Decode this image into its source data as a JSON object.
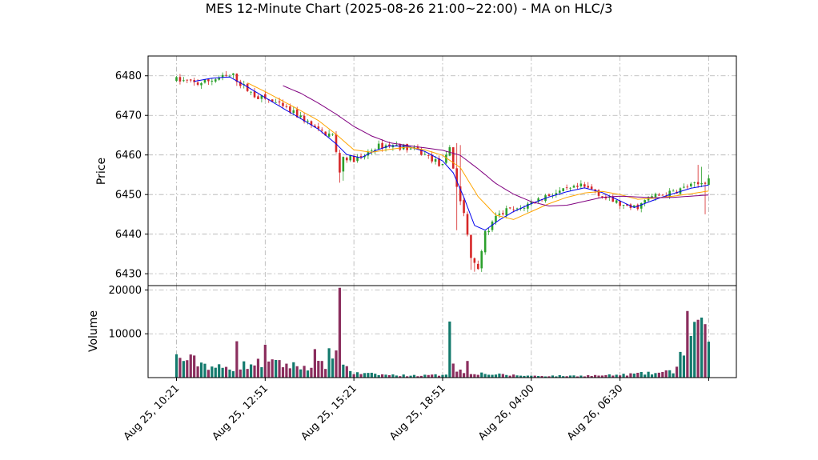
{
  "chart_data": {
    "type": "candlestick",
    "title": "MES 12-Minute Chart (2025-08-26 21:00~22:00) - MA on HLC/3",
    "price_panel": {
      "ylabel": "Price",
      "ylim": [
        6427,
        6485
      ],
      "yticks": [
        6430,
        6440,
        6450,
        6460,
        6470,
        6480
      ],
      "grid": true
    },
    "volume_panel": {
      "ylabel": "Volume",
      "ylim": [
        0,
        21000
      ],
      "yticks": [
        10000,
        20000
      ],
      "grid": true
    },
    "x_tick_labels": [
      "Aug 25, 10:21",
      "Aug 25, 12:51",
      "Aug 25, 15:21",
      "Aug 25, 18:51",
      "Aug 26, 04:00",
      "Aug 26, 06:30"
    ],
    "x_tick_bar_index": [
      0,
      25,
      50,
      75,
      100,
      125
    ],
    "bar_count": 151,
    "up_color": "#2ca02c",
    "down_color": "#d62728",
    "volume_up_color": "#137a6d",
    "volume_down_color": "#8b2e5e",
    "ma_colors": [
      "#0000ee",
      "#ffa500",
      "#800080"
    ],
    "anchors": {
      "close_keypoints": [
        [
          0,
          6479
        ],
        [
          6,
          6478
        ],
        [
          12,
          6479.5
        ],
        [
          16,
          6480
        ],
        [
          18,
          6478
        ],
        [
          22,
          6475
        ],
        [
          27,
          6473.5
        ],
        [
          32,
          6471
        ],
        [
          36,
          6469
        ],
        [
          40,
          6466
        ],
        [
          44,
          6465
        ],
        [
          46,
          6456
        ],
        [
          47,
          6459.5
        ],
        [
          50,
          6459
        ],
        [
          52,
          6459
        ],
        [
          56,
          6462
        ],
        [
          60,
          6462.5
        ],
        [
          64,
          6462
        ],
        [
          68,
          6461
        ],
        [
          72,
          6459
        ],
        [
          75,
          6457
        ],
        [
          77,
          6462
        ],
        [
          79,
          6452
        ],
        [
          81,
          6445
        ],
        [
          83,
          6434
        ],
        [
          85,
          6432
        ],
        [
          87,
          6440
        ],
        [
          90,
          6444
        ],
        [
          93,
          6446
        ],
        [
          96,
          6446
        ],
        [
          100,
          6448
        ],
        [
          105,
          6450
        ],
        [
          110,
          6451
        ],
        [
          114,
          6452
        ],
        [
          118,
          6451
        ],
        [
          121,
          6449
        ],
        [
          124,
          6448
        ],
        [
          127,
          6446.5
        ],
        [
          130,
          6447
        ],
        [
          134,
          6449.5
        ],
        [
          138,
          6450
        ],
        [
          141,
          6451
        ],
        [
          144,
          6452
        ],
        [
          147,
          6452.5
        ],
        [
          150,
          6454
        ]
      ],
      "volume_keypoints": [
        [
          0,
          4500
        ],
        [
          5,
          3800
        ],
        [
          10,
          2500
        ],
        [
          15,
          2000
        ],
        [
          20,
          3000
        ],
        [
          25,
          3200
        ],
        [
          30,
          3000
        ],
        [
          35,
          2500
        ],
        [
          40,
          2800
        ],
        [
          45,
          3200
        ],
        [
          48,
          2500
        ],
        [
          50,
          1000
        ],
        [
          55,
          800
        ],
        [
          60,
          600
        ],
        [
          65,
          500
        ],
        [
          70,
          500
        ],
        [
          74,
          600
        ],
        [
          80,
          1500
        ],
        [
          85,
          1000
        ],
        [
          90,
          700
        ],
        [
          100,
          400
        ],
        [
          110,
          400
        ],
        [
          120,
          500
        ],
        [
          125,
          600
        ],
        [
          130,
          900
        ],
        [
          135,
          1000
        ],
        [
          140,
          1400
        ],
        [
          142,
          5000
        ],
        [
          146,
          9500
        ],
        [
          148,
          11000
        ],
        [
          150,
          3800
        ]
      ],
      "volume_spikes": [
        [
          46,
          20500
        ],
        [
          45,
          6200
        ],
        [
          77,
          12800
        ],
        [
          78,
          3200
        ],
        [
          82,
          3800
        ],
        [
          17,
          8300
        ],
        [
          23,
          4300
        ],
        [
          25,
          7500
        ],
        [
          29,
          4000
        ],
        [
          39,
          6500
        ],
        [
          43,
          6700
        ],
        [
          144,
          15200
        ],
        [
          145,
          9500
        ],
        [
          147,
          13200
        ],
        [
          148,
          13700
        ],
        [
          149,
          12200
        ],
        [
          150,
          8200
        ]
      ],
      "low_wicks": [
        [
          46,
          6453
        ],
        [
          47,
          6453.5
        ],
        [
          79,
          6441
        ],
        [
          83,
          6431
        ],
        [
          84,
          6430.5
        ],
        [
          85,
          6431
        ],
        [
          149,
          6445
        ]
      ],
      "high_wicks": [
        [
          79,
          6463
        ],
        [
          80,
          6462.5
        ],
        [
          148,
          6457
        ],
        [
          147,
          6457.5
        ]
      ],
      "ma_fast_points": [
        [
          5,
          6478.6
        ],
        [
          10,
          6479.4
        ],
        [
          15,
          6479.7
        ],
        [
          20,
          6477.2
        ],
        [
          25,
          6474.5
        ],
        [
          30,
          6471.8
        ],
        [
          35,
          6469.2
        ],
        [
          40,
          6466.5
        ],
        [
          45,
          6462.8
        ],
        [
          48,
          6460.1
        ],
        [
          52,
          6459.3
        ],
        [
          56,
          6461.1
        ],
        [
          60,
          6462.3
        ],
        [
          65,
          6462.2
        ],
        [
          70,
          6460.9
        ],
        [
          75,
          6458.5
        ],
        [
          78,
          6455.5
        ],
        [
          81,
          6449.3
        ],
        [
          84,
          6442.2
        ],
        [
          87,
          6441
        ],
        [
          91,
          6443.6
        ],
        [
          95,
          6445.7
        ],
        [
          100,
          6447.7
        ],
        [
          105,
          6449.4
        ],
        [
          110,
          6450.7
        ],
        [
          115,
          6451.7
        ],
        [
          120,
          6450.5
        ],
        [
          125,
          6448.4
        ],
        [
          129,
          6446.7
        ],
        [
          133,
          6448.1
        ],
        [
          137,
          6449.4
        ],
        [
          141,
          6450.5
        ],
        [
          145,
          6451.6
        ],
        [
          150,
          6452.4
        ]
      ],
      "ma_mid_points": [
        [
          20,
          6478.2
        ],
        [
          25,
          6476
        ],
        [
          30,
          6473.6
        ],
        [
          35,
          6471.2
        ],
        [
          40,
          6468.7
        ],
        [
          45,
          6465.2
        ],
        [
          50,
          6461.3
        ],
        [
          55,
          6460.7
        ],
        [
          60,
          6461.4
        ],
        [
          65,
          6462
        ],
        [
          70,
          6461.3
        ],
        [
          75,
          6459.9
        ],
        [
          80,
          6456.8
        ],
        [
          85,
          6449.5
        ],
        [
          90,
          6444.8
        ],
        [
          95,
          6443.7
        ],
        [
          100,
          6445.7
        ],
        [
          105,
          6447.7
        ],
        [
          110,
          6449.3
        ],
        [
          115,
          6450.4
        ],
        [
          120,
          6450.8
        ],
        [
          125,
          6450
        ],
        [
          130,
          6448.8
        ],
        [
          135,
          6449.1
        ],
        [
          140,
          6449.6
        ],
        [
          145,
          6450.2
        ],
        [
          150,
          6450.9
        ]
      ],
      "ma_slow_points": [
        [
          30,
          6477.5
        ],
        [
          35,
          6475.6
        ],
        [
          40,
          6473.1
        ],
        [
          45,
          6470.3
        ],
        [
          50,
          6467.2
        ],
        [
          55,
          6464.8
        ],
        [
          60,
          6463.1
        ],
        [
          65,
          6462.4
        ],
        [
          70,
          6461.8
        ],
        [
          75,
          6461.2
        ],
        [
          80,
          6459.9
        ],
        [
          85,
          6456.5
        ],
        [
          90,
          6452.8
        ],
        [
          95,
          6450.1
        ],
        [
          100,
          6448.2
        ],
        [
          105,
          6447.1
        ],
        [
          110,
          6447.3
        ],
        [
          115,
          6448.3
        ],
        [
          120,
          6449.3
        ],
        [
          125,
          6449.6
        ],
        [
          130,
          6449.4
        ],
        [
          135,
          6449.2
        ],
        [
          140,
          6449.3
        ],
        [
          145,
          6449.6
        ],
        [
          150,
          6449.9
        ]
      ]
    }
  }
}
